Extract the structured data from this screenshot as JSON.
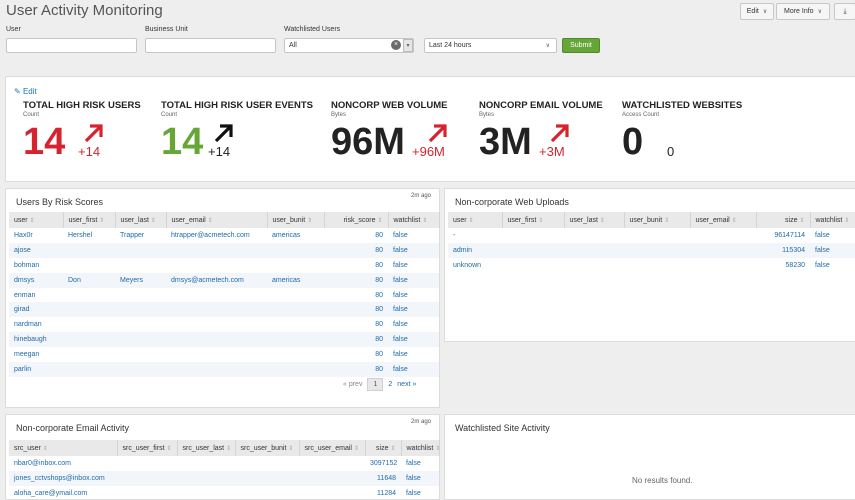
{
  "header": {
    "title": "User Activity Monitoring",
    "edit_label": "Edit",
    "more_info_label": "More Info",
    "download_icon": "download-icon"
  },
  "filters": {
    "user_label": "User",
    "user_value": "",
    "bunit_label": "Business Unit",
    "bunit_value": "",
    "watchlisted_label": "Watchlisted Users",
    "watchlisted_value": "All",
    "time_value": "Last 24 hours",
    "submit_label": "Submit"
  },
  "kpis": {
    "edit_label": "Edit",
    "items": [
      {
        "title": "TOTAL HIGH RISK USERS",
        "sub": "Count",
        "value": "14",
        "delta": "+14",
        "color": "#d6242e",
        "arrow_color": "#d6242e"
      },
      {
        "title": "TOTAL HIGH RISK USER EVENTS",
        "sub": "Count",
        "value": "14",
        "delta": "+14",
        "color": "#65a637",
        "arrow_color": "#111111"
      },
      {
        "title": "NONCORP WEB VOLUME",
        "sub": "Bytes",
        "value": "96M",
        "delta": "+96M",
        "color": "#222222",
        "arrow_color": "#d6242e"
      },
      {
        "title": "NONCORP EMAIL VOLUME",
        "sub": "Bytes",
        "value": "3M",
        "delta": "+3M",
        "color": "#222222",
        "arrow_color": "#d6242e"
      },
      {
        "title": "WATCHLISTED WEBSITES",
        "sub": "Access Count",
        "value": "0",
        "delta": "0",
        "color": "#222222",
        "arrow_color": "none"
      }
    ]
  },
  "risk_panel": {
    "title": "Users By Risk Scores",
    "ago": "2m ago",
    "columns": [
      "user",
      "user_first",
      "user_last",
      "user_email",
      "user_bunit",
      "risk_score",
      "watchlist"
    ],
    "rows": [
      [
        "Hax0r",
        "Hershel",
        "Trapper",
        "htrapper@acmetech.com",
        "americas",
        "80",
        "false"
      ],
      [
        "ajose",
        "",
        "",
        "",
        "",
        "80",
        "false"
      ],
      [
        "bohman",
        "",
        "",
        "",
        "",
        "80",
        "false"
      ],
      [
        "dmsys",
        "Don",
        "Meyers",
        "dmsys@acmetech.com",
        "americas",
        "80",
        "false"
      ],
      [
        "enman",
        "",
        "",
        "",
        "",
        "80",
        "false"
      ],
      [
        "girad",
        "",
        "",
        "",
        "",
        "80",
        "false"
      ],
      [
        "nardman",
        "",
        "",
        "",
        "",
        "80",
        "false"
      ],
      [
        "hinebaugh",
        "",
        "",
        "",
        "",
        "80",
        "false"
      ],
      [
        "meegan",
        "",
        "",
        "",
        "",
        "80",
        "false"
      ],
      [
        "parlin",
        "",
        "",
        "",
        "",
        "80",
        "false"
      ]
    ],
    "pager": {
      "prev": "« prev",
      "page1": "1",
      "page2": "2",
      "next": "next »"
    }
  },
  "web_panel": {
    "title": "Non-corporate Web Uploads",
    "columns": [
      "user",
      "user_first",
      "user_last",
      "user_bunit",
      "user_email",
      "size",
      "watchlist"
    ],
    "rows": [
      [
        "-",
        "",
        "",
        "",
        "",
        "96147114",
        "false"
      ],
      [
        "admin",
        "",
        "",
        "",
        "",
        "115304",
        "false"
      ],
      [
        "unknown",
        "",
        "",
        "",
        "",
        "58230",
        "false"
      ]
    ]
  },
  "email_panel": {
    "title": "Non-corporate Email Activity",
    "ago": "2m ago",
    "columns": [
      "src_user",
      "src_user_first",
      "src_user_last",
      "src_user_bunit",
      "src_user_email",
      "size",
      "watchlist"
    ],
    "rows": [
      [
        "nbar0@inbox.com",
        "",
        "",
        "",
        "",
        "3097152",
        "false"
      ],
      [
        "jones_cctvshops@inbox.com",
        "",
        "",
        "",
        "",
        "11648",
        "false"
      ],
      [
        "aloha_care@ymail.com",
        "",
        "",
        "",
        "",
        "11284",
        "false"
      ]
    ]
  },
  "watch_panel": {
    "title": "Watchlisted Site Activity",
    "empty": "No results found."
  }
}
